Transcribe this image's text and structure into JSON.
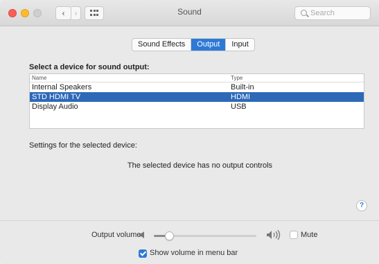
{
  "window": {
    "title": "Sound",
    "search_placeholder": "Search",
    "back_label": "‹",
    "forward_label": "›"
  },
  "tabs": [
    {
      "label": "Sound Effects",
      "active": false
    },
    {
      "label": "Output",
      "active": true
    },
    {
      "label": "Input",
      "active": false
    }
  ],
  "output": {
    "select_label": "Select a device for sound output:",
    "columns": {
      "name": "Name",
      "type": "Type"
    },
    "devices": [
      {
        "name": "Internal Speakers",
        "type": "Built-in",
        "selected": false
      },
      {
        "name": "STD HDMI TV",
        "type": "HDMI",
        "selected": true
      },
      {
        "name": "Display Audio",
        "type": "USB",
        "selected": false
      }
    ],
    "settings_label": "Settings for the selected device:",
    "no_controls_text": "The selected device has no output controls"
  },
  "help_label": "?",
  "volume": {
    "label": "Output volume:",
    "level": 0.12,
    "mute_label": "Mute",
    "mute_checked": false
  },
  "show_in_menu_bar": {
    "label": "Show volume in menu bar",
    "checked": true
  },
  "colors": {
    "accent": "#2d79d6",
    "selection": "#2d69b8"
  },
  "icons": {
    "speaker_low": "speaker-low-icon",
    "speaker_high": "speaker-high-icon",
    "search": "search-icon",
    "grid": "grid-icon"
  }
}
